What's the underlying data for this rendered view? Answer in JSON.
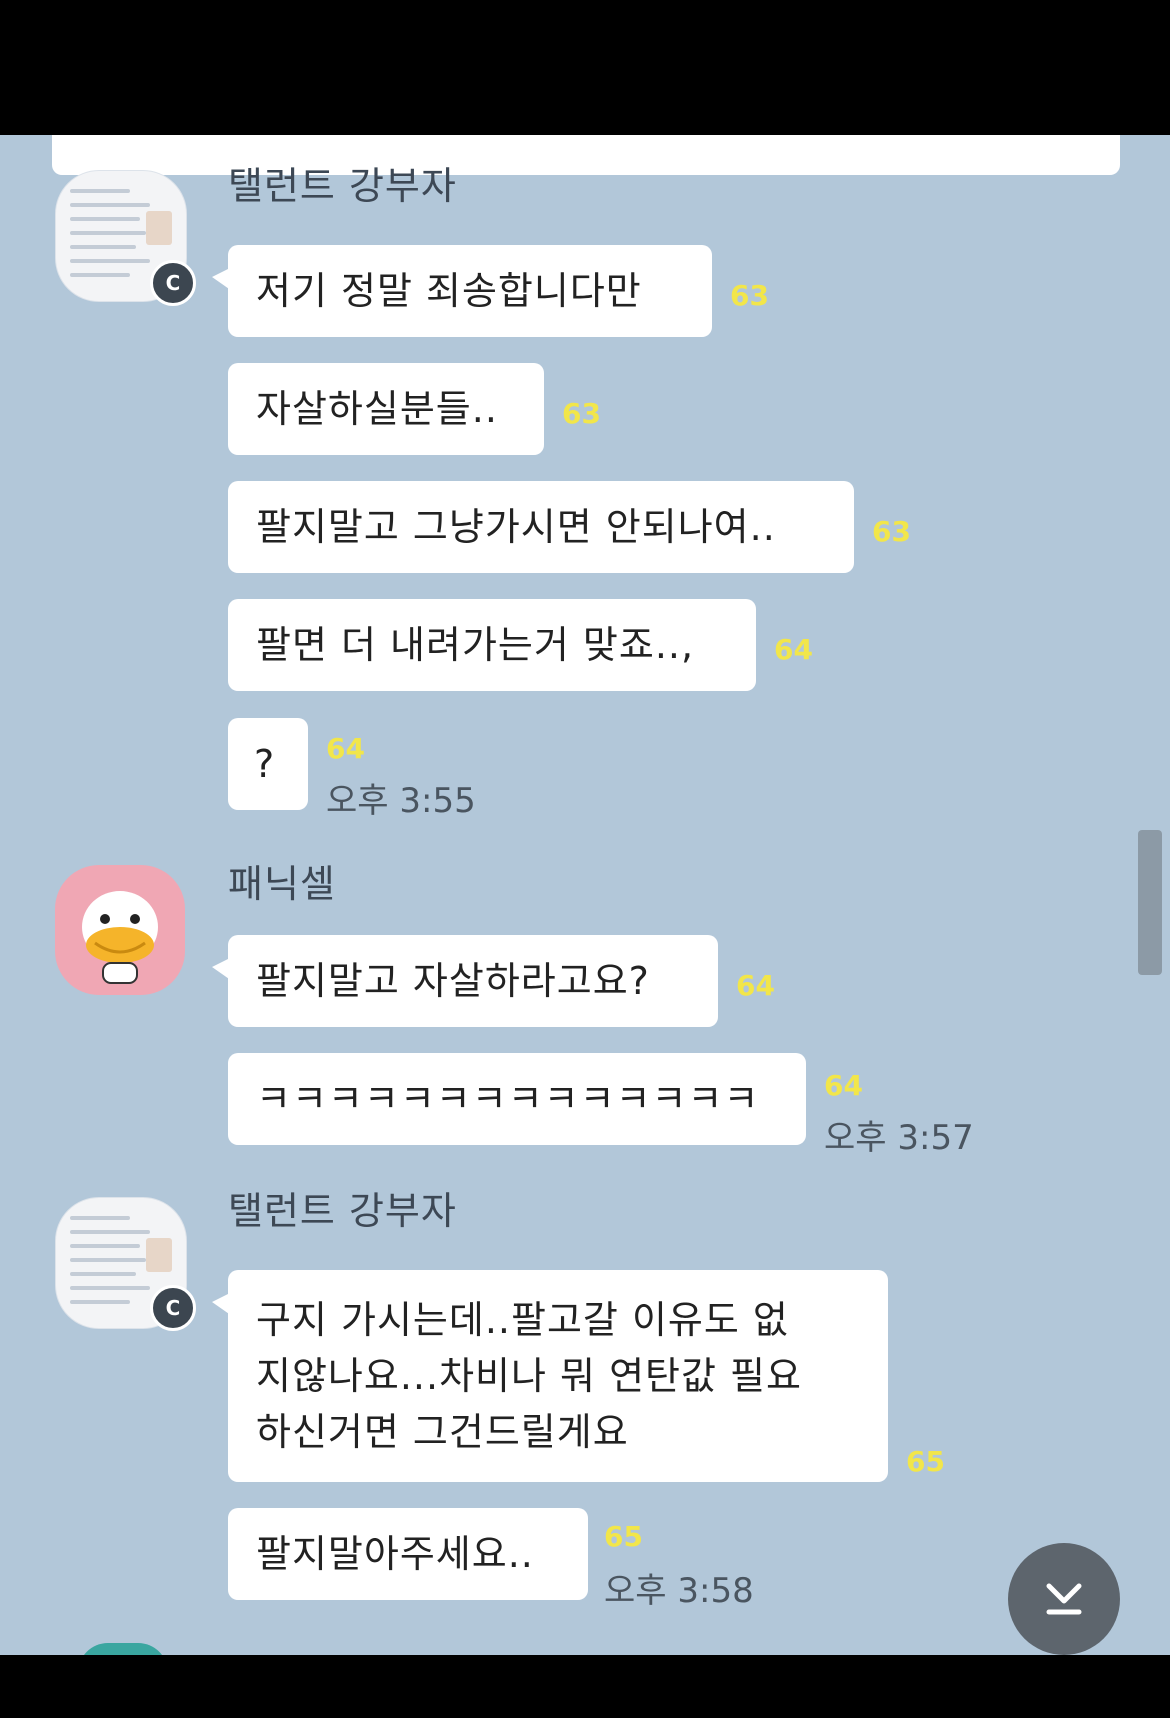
{
  "messages_group_1": {
    "sender": "탤런트 강부자",
    "badge": "C",
    "bubbles": [
      {
        "text": "저기 정말 죄송합니다만",
        "count": "63"
      },
      {
        "text": "자살하실분들..",
        "count": "63"
      },
      {
        "text": "팔지말고 그냥가시면 안되나여..",
        "count": "63"
      },
      {
        "text": "팔면 더 내려가는거 맞죠..,",
        "count": "64"
      },
      {
        "text": "?",
        "count": "64",
        "time": "오후 3:55"
      }
    ]
  },
  "messages_group_2": {
    "sender": "패닉셀",
    "bubbles": [
      {
        "text": "팔지말고 자살하라고요?",
        "count": "64"
      },
      {
        "text": "ㅋㅋㅋㅋㅋㅋㅋㅋㅋㅋㅋㅋㅋㅋ",
        "count": "64",
        "time": "오후 3:57"
      }
    ]
  },
  "messages_group_3": {
    "sender": "탤런트 강부자",
    "badge": "C",
    "bubbles": [
      {
        "text": "구지 가시는데..팔고갈 이유도 없\n지않나요...차비나 뭐 연탄값 필요\n하신거면 그건드릴게요",
        "count": "65"
      },
      {
        "text": "팔지말아주세요..",
        "count": "65",
        "time": "오후 3:58"
      }
    ]
  },
  "icons": {
    "scroll_down": "chevron-down-to-bottom-icon",
    "badge_icon": "channel-badge-icon"
  },
  "colors": {
    "background": "#b2c7d9",
    "bubble": "#ffffff",
    "unread_count": "#f2e64a",
    "duck_avatar": "#f0a7b4"
  }
}
